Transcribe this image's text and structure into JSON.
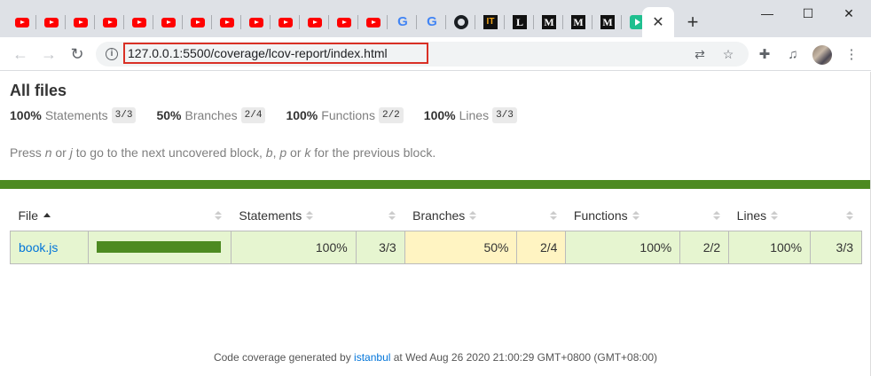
{
  "browser": {
    "tabs": [
      {
        "icon": "youtube-icon"
      },
      {
        "icon": "youtube-icon"
      },
      {
        "icon": "youtube-icon"
      },
      {
        "icon": "youtube-icon"
      },
      {
        "icon": "youtube-icon"
      },
      {
        "icon": "youtube-icon"
      },
      {
        "icon": "youtube-icon"
      },
      {
        "icon": "youtube-icon"
      },
      {
        "icon": "youtube-icon"
      },
      {
        "icon": "youtube-icon"
      },
      {
        "icon": "youtube-icon"
      },
      {
        "icon": "youtube-icon"
      },
      {
        "icon": "youtube-icon"
      },
      {
        "icon": "google-icon"
      },
      {
        "icon": "google-icon"
      },
      {
        "icon": "github-icon"
      },
      {
        "icon": "it-icon"
      },
      {
        "icon": "l-icon"
      },
      {
        "icon": "medium-icon"
      },
      {
        "icon": "medium-icon"
      },
      {
        "icon": "medium-icon"
      },
      {
        "icon": "play-icon"
      }
    ],
    "favicon_text": {
      "google": "G",
      "it": "IT",
      "l": "L",
      "medium": "M"
    },
    "active_tab_close": "✕",
    "new_tab": "+",
    "window_controls": {
      "minimize": "—",
      "maximize": "☐",
      "close": "✕"
    },
    "nav": {
      "back": "←",
      "forward": "→",
      "reload": "↻"
    },
    "url": "127.0.0.1:5500/coverage/lcov-report/index.html",
    "info_icon": "i",
    "toolbar_icons": {
      "translate": "⇄",
      "star": "☆",
      "extensions": "✚",
      "media": "♫",
      "menu": "⋮"
    }
  },
  "report": {
    "title": "All files",
    "summary": [
      {
        "pct": "100%",
        "label": "Statements",
        "fraction": "3/3"
      },
      {
        "pct": "50%",
        "label": "Branches",
        "fraction": "2/4"
      },
      {
        "pct": "100%",
        "label": "Functions",
        "fraction": "2/2"
      },
      {
        "pct": "100%",
        "label": "Lines",
        "fraction": "3/3"
      }
    ],
    "hint": {
      "p1": "Press ",
      "n": "n",
      "p2": " or ",
      "j": "j",
      "p3": " to go to the next uncovered block, ",
      "b": "b",
      "p4": ", ",
      "p": "p",
      "p5": " or ",
      "k": "k",
      "p6": " for the previous block."
    },
    "columns": {
      "file": "File",
      "statements": "Statements",
      "branches": "Branches",
      "functions": "Functions",
      "lines": "Lines"
    },
    "rows": [
      {
        "file": "book.js",
        "coverage_fraction": 1.0,
        "statements_pct": "100%",
        "statements_frac": "3/3",
        "branches_pct": "50%",
        "branches_frac": "2/4",
        "functions_pct": "100%",
        "functions_frac": "2/2",
        "lines_pct": "100%",
        "lines_frac": "3/3"
      }
    ],
    "footer": {
      "prefix": "Code coverage generated by ",
      "link": "istanbul",
      "suffix": " at Wed Aug 26 2020 21:00:29 GMT+0800 (GMT+08:00)"
    }
  },
  "colors": {
    "high": "#e6f5d0",
    "medium": "#fff4c2",
    "status_bar": "#4d8a21",
    "url_highlight": "#d93025",
    "link": "#0074d9"
  }
}
